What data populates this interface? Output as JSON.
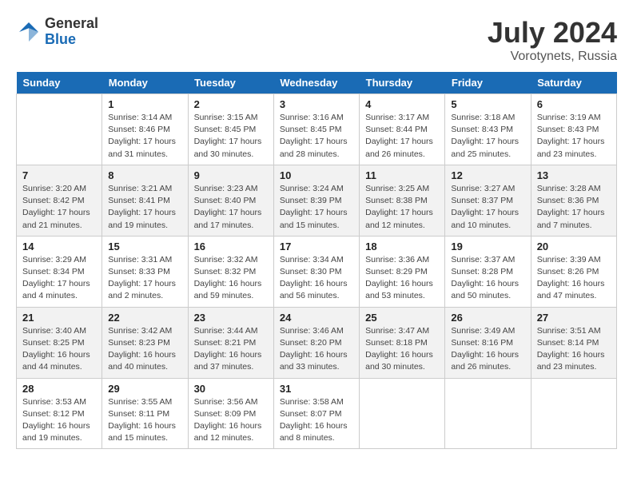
{
  "header": {
    "logo_general": "General",
    "logo_blue": "Blue",
    "month_title": "July 2024",
    "location": "Vorotynets, Russia"
  },
  "days_of_week": [
    "Sunday",
    "Monday",
    "Tuesday",
    "Wednesday",
    "Thursday",
    "Friday",
    "Saturday"
  ],
  "weeks": [
    [
      {
        "day": "",
        "info": ""
      },
      {
        "day": "1",
        "info": "Sunrise: 3:14 AM\nSunset: 8:46 PM\nDaylight: 17 hours\nand 31 minutes."
      },
      {
        "day": "2",
        "info": "Sunrise: 3:15 AM\nSunset: 8:45 PM\nDaylight: 17 hours\nand 30 minutes."
      },
      {
        "day": "3",
        "info": "Sunrise: 3:16 AM\nSunset: 8:45 PM\nDaylight: 17 hours\nand 28 minutes."
      },
      {
        "day": "4",
        "info": "Sunrise: 3:17 AM\nSunset: 8:44 PM\nDaylight: 17 hours\nand 26 minutes."
      },
      {
        "day": "5",
        "info": "Sunrise: 3:18 AM\nSunset: 8:43 PM\nDaylight: 17 hours\nand 25 minutes."
      },
      {
        "day": "6",
        "info": "Sunrise: 3:19 AM\nSunset: 8:43 PM\nDaylight: 17 hours\nand 23 minutes."
      }
    ],
    [
      {
        "day": "7",
        "info": "Sunrise: 3:20 AM\nSunset: 8:42 PM\nDaylight: 17 hours\nand 21 minutes."
      },
      {
        "day": "8",
        "info": "Sunrise: 3:21 AM\nSunset: 8:41 PM\nDaylight: 17 hours\nand 19 minutes."
      },
      {
        "day": "9",
        "info": "Sunrise: 3:23 AM\nSunset: 8:40 PM\nDaylight: 17 hours\nand 17 minutes."
      },
      {
        "day": "10",
        "info": "Sunrise: 3:24 AM\nSunset: 8:39 PM\nDaylight: 17 hours\nand 15 minutes."
      },
      {
        "day": "11",
        "info": "Sunrise: 3:25 AM\nSunset: 8:38 PM\nDaylight: 17 hours\nand 12 minutes."
      },
      {
        "day": "12",
        "info": "Sunrise: 3:27 AM\nSunset: 8:37 PM\nDaylight: 17 hours\nand 10 minutes."
      },
      {
        "day": "13",
        "info": "Sunrise: 3:28 AM\nSunset: 8:36 PM\nDaylight: 17 hours\nand 7 minutes."
      }
    ],
    [
      {
        "day": "14",
        "info": "Sunrise: 3:29 AM\nSunset: 8:34 PM\nDaylight: 17 hours\nand 4 minutes."
      },
      {
        "day": "15",
        "info": "Sunrise: 3:31 AM\nSunset: 8:33 PM\nDaylight: 17 hours\nand 2 minutes."
      },
      {
        "day": "16",
        "info": "Sunrise: 3:32 AM\nSunset: 8:32 PM\nDaylight: 16 hours\nand 59 minutes."
      },
      {
        "day": "17",
        "info": "Sunrise: 3:34 AM\nSunset: 8:30 PM\nDaylight: 16 hours\nand 56 minutes."
      },
      {
        "day": "18",
        "info": "Sunrise: 3:36 AM\nSunset: 8:29 PM\nDaylight: 16 hours\nand 53 minutes."
      },
      {
        "day": "19",
        "info": "Sunrise: 3:37 AM\nSunset: 8:28 PM\nDaylight: 16 hours\nand 50 minutes."
      },
      {
        "day": "20",
        "info": "Sunrise: 3:39 AM\nSunset: 8:26 PM\nDaylight: 16 hours\nand 47 minutes."
      }
    ],
    [
      {
        "day": "21",
        "info": "Sunrise: 3:40 AM\nSunset: 8:25 PM\nDaylight: 16 hours\nand 44 minutes."
      },
      {
        "day": "22",
        "info": "Sunrise: 3:42 AM\nSunset: 8:23 PM\nDaylight: 16 hours\nand 40 minutes."
      },
      {
        "day": "23",
        "info": "Sunrise: 3:44 AM\nSunset: 8:21 PM\nDaylight: 16 hours\nand 37 minutes."
      },
      {
        "day": "24",
        "info": "Sunrise: 3:46 AM\nSunset: 8:20 PM\nDaylight: 16 hours\nand 33 minutes."
      },
      {
        "day": "25",
        "info": "Sunrise: 3:47 AM\nSunset: 8:18 PM\nDaylight: 16 hours\nand 30 minutes."
      },
      {
        "day": "26",
        "info": "Sunrise: 3:49 AM\nSunset: 8:16 PM\nDaylight: 16 hours\nand 26 minutes."
      },
      {
        "day": "27",
        "info": "Sunrise: 3:51 AM\nSunset: 8:14 PM\nDaylight: 16 hours\nand 23 minutes."
      }
    ],
    [
      {
        "day": "28",
        "info": "Sunrise: 3:53 AM\nSunset: 8:12 PM\nDaylight: 16 hours\nand 19 minutes."
      },
      {
        "day": "29",
        "info": "Sunrise: 3:55 AM\nSunset: 8:11 PM\nDaylight: 16 hours\nand 15 minutes."
      },
      {
        "day": "30",
        "info": "Sunrise: 3:56 AM\nSunset: 8:09 PM\nDaylight: 16 hours\nand 12 minutes."
      },
      {
        "day": "31",
        "info": "Sunrise: 3:58 AM\nSunset: 8:07 PM\nDaylight: 16 hours\nand 8 minutes."
      },
      {
        "day": "",
        "info": ""
      },
      {
        "day": "",
        "info": ""
      },
      {
        "day": "",
        "info": ""
      }
    ]
  ]
}
